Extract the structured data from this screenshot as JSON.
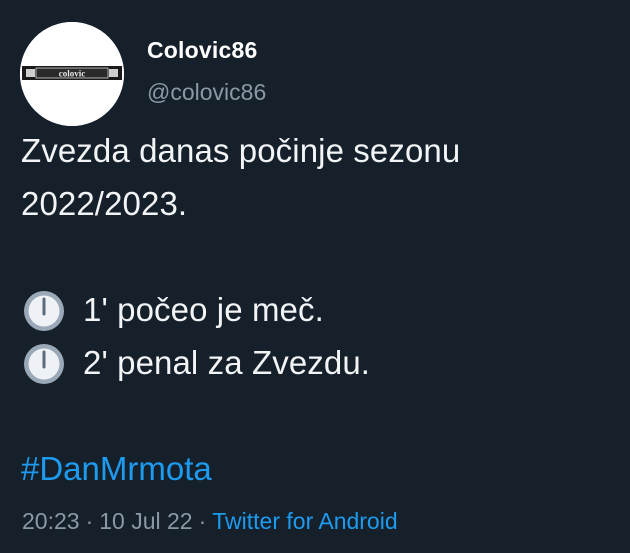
{
  "user": {
    "display_name": "Colovic86",
    "handle": "@colovic86",
    "avatar_text": "colovic"
  },
  "tweet": {
    "lines": [
      "Zvezda danas počinje sezonu",
      "2022/2023."
    ],
    "events": [
      {
        "icon": "clock-icon",
        "text": "1' počeo je meč."
      },
      {
        "icon": "clock-icon",
        "text": "2' penal za Zvezdu."
      }
    ],
    "hashtag": "#DanMrmota"
  },
  "meta": {
    "time": "20:23",
    "separator": "·",
    "date": "10 Jul 22",
    "source": "Twitter for Android"
  },
  "colors": {
    "background": "#15202b",
    "text": "#ffffff",
    "muted": "#8b98a5",
    "link": "#1d9bf0"
  }
}
